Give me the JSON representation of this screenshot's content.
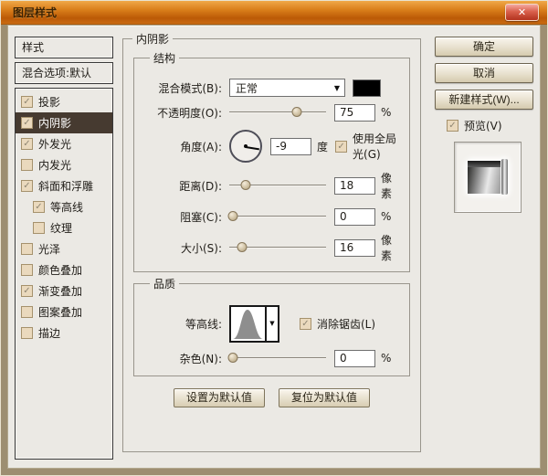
{
  "window": {
    "title": "图层样式",
    "close_label": "✕"
  },
  "sidebar": {
    "styles_item": "样式",
    "blending_item": "混合选项:默认",
    "items": [
      {
        "label": "投影",
        "checked": true,
        "selected": false,
        "indent": false
      },
      {
        "label": "内阴影",
        "checked": true,
        "selected": true,
        "indent": false
      },
      {
        "label": "外发光",
        "checked": true,
        "selected": false,
        "indent": false
      },
      {
        "label": "内发光",
        "checked": false,
        "selected": false,
        "indent": false
      },
      {
        "label": "斜面和浮雕",
        "checked": true,
        "selected": false,
        "indent": false
      },
      {
        "label": "等高线",
        "checked": true,
        "selected": false,
        "indent": true
      },
      {
        "label": "纹理",
        "checked": false,
        "selected": false,
        "indent": true
      },
      {
        "label": "光泽",
        "checked": false,
        "selected": false,
        "indent": false
      },
      {
        "label": "颜色叠加",
        "checked": false,
        "selected": false,
        "indent": false
      },
      {
        "label": "渐变叠加",
        "checked": true,
        "selected": false,
        "indent": false
      },
      {
        "label": "图案叠加",
        "checked": false,
        "selected": false,
        "indent": false
      },
      {
        "label": "描边",
        "checked": false,
        "selected": false,
        "indent": false
      }
    ]
  },
  "main": {
    "panel_title": "内阴影",
    "structure": {
      "legend": "结构",
      "blend_mode_label": "混合模式(B):",
      "blend_mode_value": "正常",
      "blend_color": "#000000",
      "opacity_label": "不透明度(O):",
      "opacity_value": "75",
      "opacity_unit": "%",
      "opacity_slider_percent": 70,
      "angle_label": "角度(A):",
      "angle_value": "-9",
      "angle_unit": "度",
      "use_global_light_label": "使用全局光(G)",
      "use_global_light_checked": true,
      "distance_label": "距离(D):",
      "distance_value": "18",
      "distance_unit": "像素",
      "distance_slider_percent": 17,
      "choke_label": "阻塞(C):",
      "choke_value": "0",
      "choke_unit": "%",
      "choke_slider_percent": 4,
      "size_label": "大小(S):",
      "size_value": "16",
      "size_unit": "像素",
      "size_slider_percent": 13
    },
    "quality": {
      "legend": "品质",
      "contour_label": "等高线:",
      "anti_alias_label": "消除锯齿(L)",
      "anti_alias_checked": true,
      "noise_label": "杂色(N):",
      "noise_value": "0",
      "noise_unit": "%",
      "noise_slider_percent": 4
    },
    "make_default_label": "设置为默认值",
    "reset_default_label": "复位为默认值"
  },
  "actions": {
    "ok_label": "确定",
    "cancel_label": "取消",
    "new_style_label": "新建样式(W)...",
    "preview_label": "预览(V)",
    "preview_checked": true
  }
}
